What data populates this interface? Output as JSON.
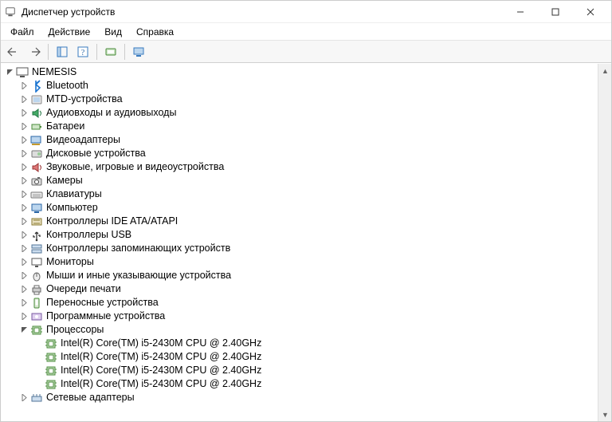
{
  "window": {
    "title": "Диспетчер устройств"
  },
  "menubar": {
    "items": [
      "Файл",
      "Действие",
      "Вид",
      "Справка"
    ]
  },
  "tree": {
    "root": {
      "label": "NEMESIS"
    },
    "categories": [
      {
        "label": "Bluetooth",
        "icon": "bluetooth"
      },
      {
        "label": "MTD-устройства",
        "icon": "mtd"
      },
      {
        "label": "Аудиовходы и аудиовыходы",
        "icon": "audio"
      },
      {
        "label": "Батареи",
        "icon": "battery"
      },
      {
        "label": "Видеоадаптеры",
        "icon": "display-adapter"
      },
      {
        "label": "Дисковые устройства",
        "icon": "disk"
      },
      {
        "label": "Звуковые, игровые и видеоустройства",
        "icon": "sound"
      },
      {
        "label": "Камеры",
        "icon": "camera"
      },
      {
        "label": "Клавиатуры",
        "icon": "keyboard"
      },
      {
        "label": "Компьютер",
        "icon": "computer"
      },
      {
        "label": "Контроллеры IDE ATA/ATAPI",
        "icon": "ide"
      },
      {
        "label": "Контроллеры USB",
        "icon": "usb"
      },
      {
        "label": "Контроллеры запоминающих устройств",
        "icon": "storage-ctrl"
      },
      {
        "label": "Мониторы",
        "icon": "monitor"
      },
      {
        "label": "Мыши и иные указывающие устройства",
        "icon": "mouse"
      },
      {
        "label": "Очереди печати",
        "icon": "printer"
      },
      {
        "label": "Переносные устройства",
        "icon": "portable"
      },
      {
        "label": "Программные устройства",
        "icon": "software"
      },
      {
        "label": "Процессоры",
        "icon": "cpu",
        "expanded": true,
        "children": [
          {
            "label": "Intel(R) Core(TM) i5-2430M CPU @ 2.40GHz",
            "icon": "cpu"
          },
          {
            "label": "Intel(R) Core(TM) i5-2430M CPU @ 2.40GHz",
            "icon": "cpu"
          },
          {
            "label": "Intel(R) Core(TM) i5-2430M CPU @ 2.40GHz",
            "icon": "cpu"
          },
          {
            "label": "Intel(R) Core(TM) i5-2430M CPU @ 2.40GHz",
            "icon": "cpu"
          }
        ]
      },
      {
        "label": "Сетевые адаптеры",
        "icon": "network"
      }
    ]
  }
}
